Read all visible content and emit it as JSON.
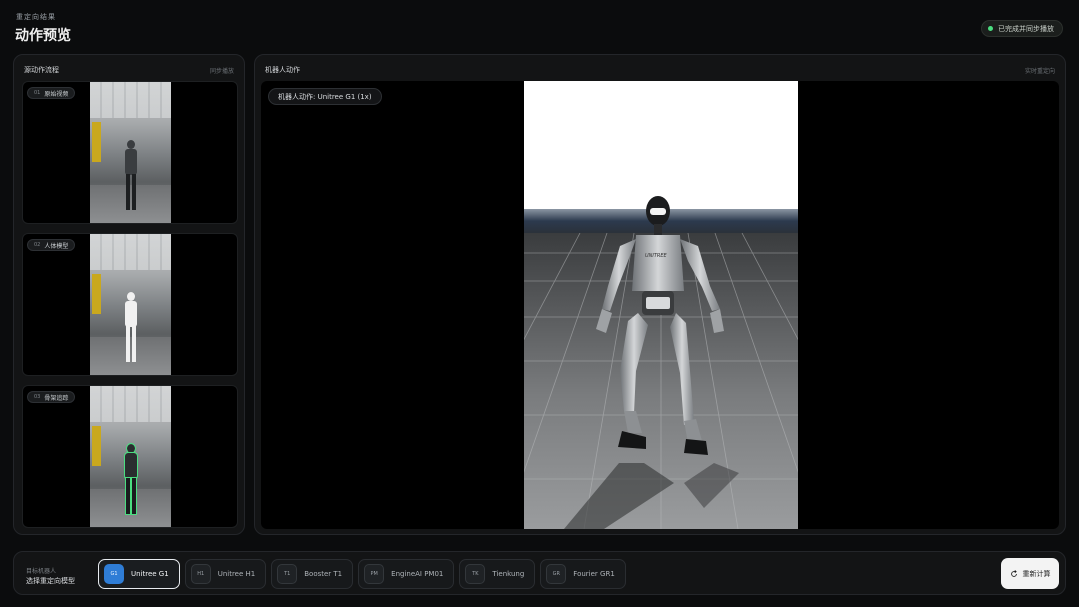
{
  "header": {
    "kicker": "重定向结果",
    "title": "动作预览",
    "status": "已完成并同步播放",
    "status_color": "#4ade80"
  },
  "source_panel": {
    "title": "源动作流程",
    "hint": "同步播放",
    "cards": [
      {
        "num": "01",
        "label": "原始视频"
      },
      {
        "num": "02",
        "label": "人体模型"
      },
      {
        "num": "03",
        "label": "骨架追踪"
      }
    ]
  },
  "robot_panel": {
    "title": "机器人动作",
    "hint": "实时重定向",
    "viewer_label": "机器人动作: Unitree G1 (1x)"
  },
  "bottom": {
    "kicker": "目标机器人",
    "title": "选择重定向模型",
    "robots": [
      {
        "code": "G1",
        "name": "Unitree G1",
        "active": true
      },
      {
        "code": "H1",
        "name": "Unitree H1",
        "active": false
      },
      {
        "code": "T1",
        "name": "Booster T1",
        "active": false
      },
      {
        "code": "PM",
        "name": "EngineAI PM01",
        "active": false
      },
      {
        "code": "TK",
        "name": "Tienkung",
        "active": false
      },
      {
        "code": "GR",
        "name": "Fourier GR1",
        "active": false
      }
    ],
    "recompute_label": "重新计算"
  },
  "colors": {
    "accent": "#2f7dd6",
    "success": "#4ade80",
    "background": "#0b0c0d"
  }
}
